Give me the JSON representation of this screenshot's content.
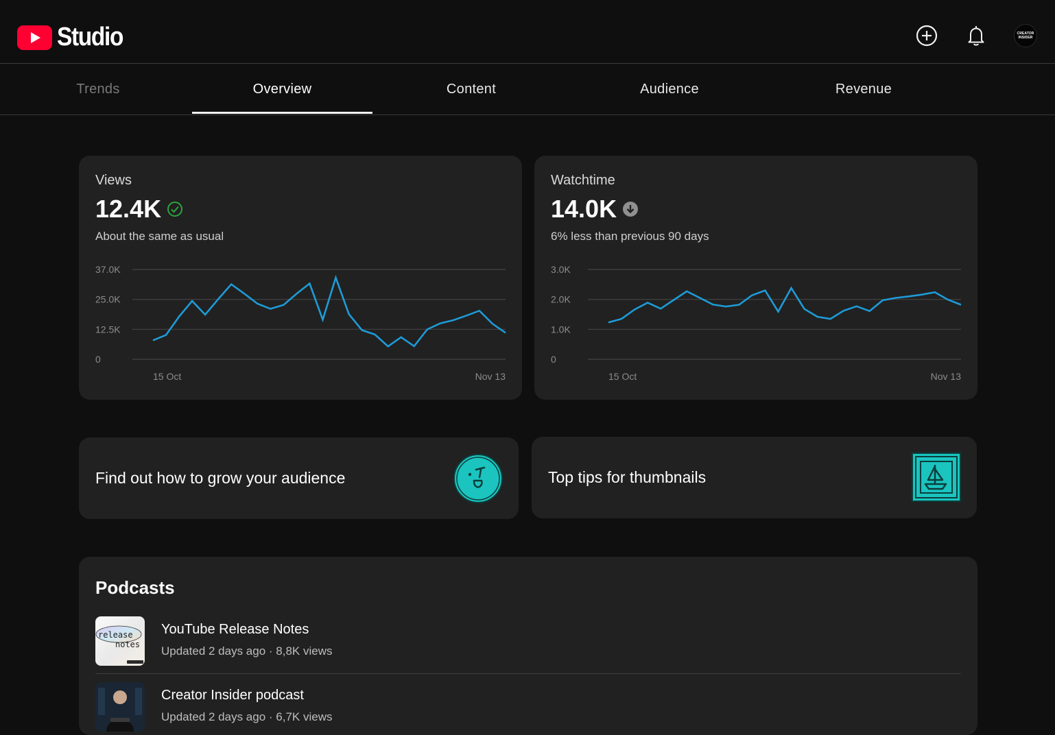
{
  "app": {
    "logo_text": "Studio",
    "avatar_line1": "CREATOR",
    "avatar_line2": "INSIDER"
  },
  "tabs": [
    {
      "label": "Trends",
      "state": "dim"
    },
    {
      "label": "Overview",
      "state": "active"
    },
    {
      "label": "Content",
      "state": "normal"
    },
    {
      "label": "Audience",
      "state": "normal"
    },
    {
      "label": "Revenue",
      "state": "normal"
    }
  ],
  "metrics": [
    {
      "label": "Views",
      "value": "12.4K",
      "status_icon": "check-circle-icon",
      "status_color": "#2ba640",
      "subtitle": "About the same as usual",
      "chart_data": {
        "type": "line",
        "y_ticks": [
          "37.0K",
          "25.0K",
          "12.5K",
          "0"
        ],
        "ylim": [
          0,
          37000
        ],
        "x_labels": [
          "15 Oct",
          "Nov 13"
        ],
        "line_color": "#1e9bd7",
        "grid": true,
        "values": [
          7800,
          10000,
          17600,
          24000,
          18400,
          24800,
          30900,
          27000,
          22900,
          20800,
          22400,
          27000,
          31200,
          16300,
          33600,
          18600,
          12000,
          10200,
          5300,
          9100,
          5400,
          12300,
          14800,
          16100,
          18000,
          20000,
          14600,
          10900
        ]
      }
    },
    {
      "label": "Watchtime",
      "value": "14.0K",
      "status_icon": "arrow-down-circle-icon",
      "status_color": "#909090",
      "subtitle": "6% less than previous 90 days",
      "chart_data": {
        "type": "line",
        "y_ticks": [
          "3.0K",
          "2.0K",
          "1.0K",
          "0"
        ],
        "ylim": [
          0,
          3000
        ],
        "x_labels": [
          "15 Oct",
          "Nov 13"
        ],
        "line_color": "#1e9bd7",
        "grid": true,
        "values": [
          1230,
          1350,
          1660,
          1890,
          1690,
          1980,
          2270,
          2050,
          1830,
          1760,
          1820,
          2140,
          2300,
          1590,
          2380,
          1680,
          1420,
          1350,
          1620,
          1770,
          1610,
          1970,
          2050,
          2100,
          2160,
          2240,
          1990,
          1820
        ]
      }
    }
  ],
  "tips": [
    {
      "title": "Find out how to grow your audience",
      "art_icon": "smiley-face-icon",
      "accent": "#1bc4bf"
    },
    {
      "title": "Top tips for thumbnails",
      "art_icon": "image-frame-icon",
      "accent": "#1bc4bf"
    }
  ],
  "podcasts": {
    "title": "Podcasts",
    "items": [
      {
        "name": "YouTube Release Notes",
        "meta": "Updated 2 days ago · 8,8K views",
        "thumb_text1": "release",
        "thumb_text2": "notes"
      },
      {
        "name": "Creator Insider podcast",
        "meta": "Updated 2 days ago · 6,7K views"
      }
    ]
  }
}
